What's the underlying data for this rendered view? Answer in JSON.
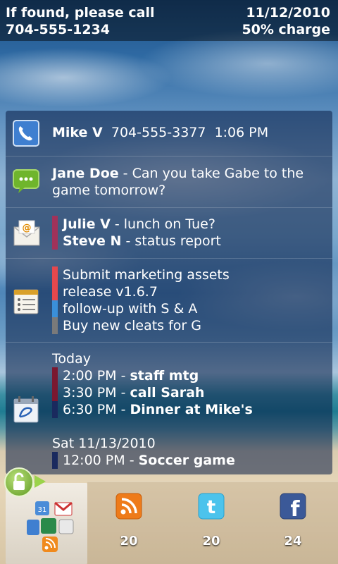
{
  "status": {
    "found_line1": "If found, please call",
    "found_line2": "704-555-1234",
    "date": "11/12/2010",
    "battery": "50% charge"
  },
  "calls": {
    "icon": "phone-icon",
    "name": "Mike V",
    "number": "704-555-3377",
    "time": "1:06 PM"
  },
  "sms": {
    "icon": "sms-icon",
    "sender": "Jane Doe",
    "separator": " - ",
    "message": "Can you take Gabe to the game tomorrow?"
  },
  "email": {
    "icon": "mail-icon",
    "items": [
      {
        "sender": "Julie V",
        "subject": "lunch on Tue?",
        "color": "#a0325a"
      },
      {
        "sender": "Steve N",
        "subject": "status report",
        "color": "#a0325a"
      }
    ]
  },
  "tasks": {
    "icon": "tasks-icon",
    "items": [
      {
        "text": "Submit marketing assets",
        "color": "#e5484d"
      },
      {
        "text": "release v1.6.7",
        "color": "#e5484d"
      },
      {
        "text": "follow-up with S & A",
        "color": "#3a8fd9"
      },
      {
        "text": "Buy new cleats for G",
        "color": "#7a7a7a"
      }
    ]
  },
  "calendar": {
    "icon": "calendar-icon",
    "day1": {
      "label": "Today",
      "events": [
        {
          "time": "2:00 PM",
          "title": "staff mtg",
          "color": "#7a1830"
        },
        {
          "time": "3:30 PM",
          "title": "call Sarah",
          "color": "#7a1830"
        },
        {
          "time": "6:30 PM",
          "title": "Dinner at Mike's",
          "color": "#1a2a5e"
        }
      ]
    },
    "day2": {
      "label": "Sat 11/13/2010",
      "events": [
        {
          "time": "12:00 PM",
          "title": "Soccer game",
          "color": "#1a2a5e"
        }
      ]
    }
  },
  "dock": {
    "rss": {
      "icon": "rss-icon",
      "count": "20"
    },
    "twitter": {
      "icon": "twitter-icon",
      "count": "20"
    },
    "facebook": {
      "icon": "facebook-icon",
      "count": "24"
    }
  }
}
